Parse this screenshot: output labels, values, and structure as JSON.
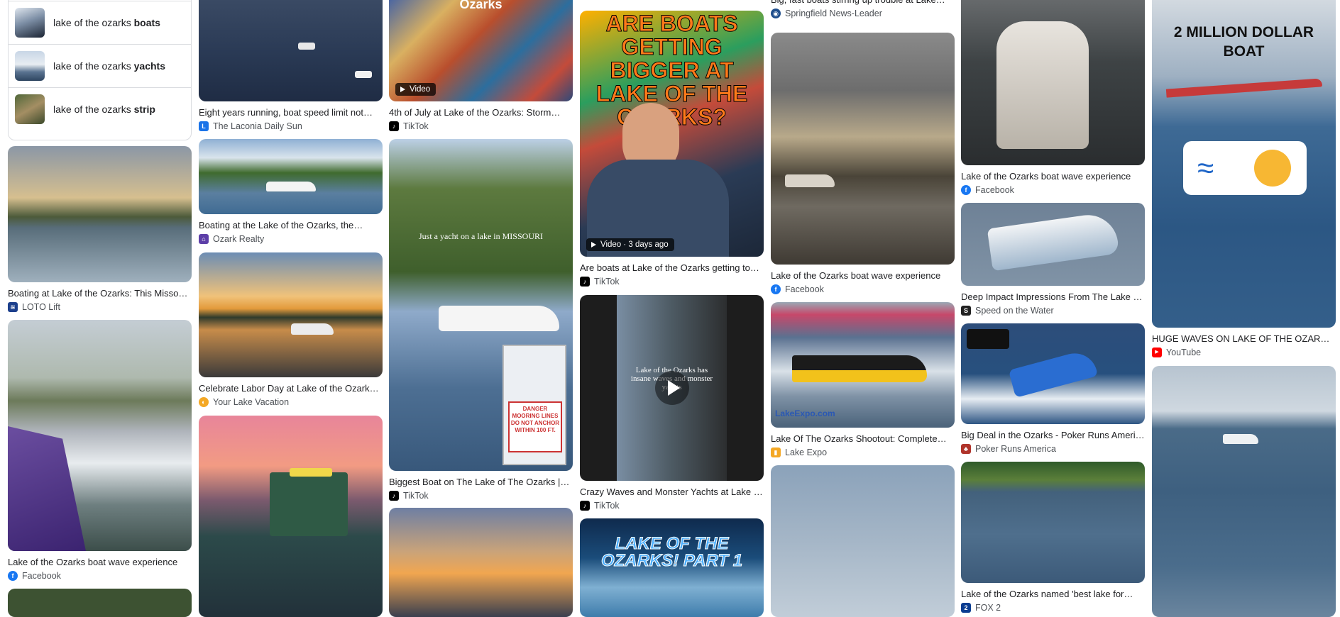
{
  "suggestions": [
    {
      "prefix": "lake of the ozarks ",
      "bold": "boats"
    },
    {
      "prefix": "lake of the ozarks ",
      "bold": "yachts"
    },
    {
      "prefix": "lake of the ozarks ",
      "bold": "strip"
    }
  ],
  "results": {
    "c0": [
      {
        "caption": "Boating at Lake of the Ozarks: This Missou…",
        "source": "LOTO Lift"
      },
      {
        "caption": "Lake of the Ozarks boat wave experience",
        "source": "Facebook"
      }
    ],
    "c1": [
      {
        "caption": "Eight years running, boat speed limit not…",
        "source": "The Laconia Daily Sun"
      },
      {
        "caption": "Boating at the Lake of the Ozarks, the…",
        "source": "Ozark Realty"
      },
      {
        "caption": "Celebrate Labor Day at Lake of the Ozarks…",
        "source": "Your Lake Vacation"
      }
    ],
    "c2": [
      {
        "caption": "4th of July at Lake of the Ozarks: Storm…",
        "source": "TikTok",
        "badge": "Video",
        "overlay": "Ozarks"
      },
      {
        "caption": "Biggest Boat on The Lake of The Ozarks |…",
        "source": "TikTok",
        "overlay": "Just a yacht on a lake in MISSOURI",
        "sign": "DANGER MOORING LINES DO NOT ANCHOR WITHIN 100 FT."
      }
    ],
    "c3": [
      {
        "caption": "Are boats at Lake of the Ozarks getting to…",
        "source": "TikTok",
        "badge": "Video · 3 days ago",
        "overlay": "ARE BOATS GETTING BIGGER AT LAKE OF THE OZARKS?"
      },
      {
        "caption": "Crazy Waves and Monster Yachts at Lake o…",
        "source": "TikTok",
        "overlay": "Lake of the Ozarks has insane waves and monster yachts"
      },
      {
        "overlay": "LAKE OF THE OZARKS! PART 1"
      }
    ],
    "c4": [
      {
        "caption": "Big, fast boats stirring up trouble at Lake…",
        "source": "Springfield News-Leader"
      },
      {
        "caption": "Lake of the Ozarks boat wave experience",
        "source": "Facebook"
      },
      {
        "caption": "Lake Of The Ozarks Shootout: Complete…",
        "source": "Lake Expo",
        "overlay": "LakeExpo.com"
      }
    ],
    "c5": [
      {
        "caption": "Lake of the Ozarks boat wave experience",
        "source": "Facebook"
      },
      {
        "caption": "Deep Impact Impressions From The Lake O…",
        "source": "Speed on the Water"
      },
      {
        "caption": "Big Deal in the Ozarks - Poker Runs America",
        "source": "Poker Runs America"
      },
      {
        "caption": "Lake of the Ozarks named 'best lake for…",
        "source": "FOX 2"
      }
    ],
    "c6": [
      {
        "caption": "HUGE WAVES ON LAKE OF THE OZARKS…",
        "source": "YouTube",
        "overlay": "2 MILLION DOLLAR BOAT"
      }
    ]
  },
  "colors": {
    "facebook": "#1877f2",
    "tiktok": "#000000",
    "youtube": "#ff0000",
    "fox2": "#0b3d91",
    "springfield": "#1f4e8c",
    "laconia": "#1a73e8"
  }
}
